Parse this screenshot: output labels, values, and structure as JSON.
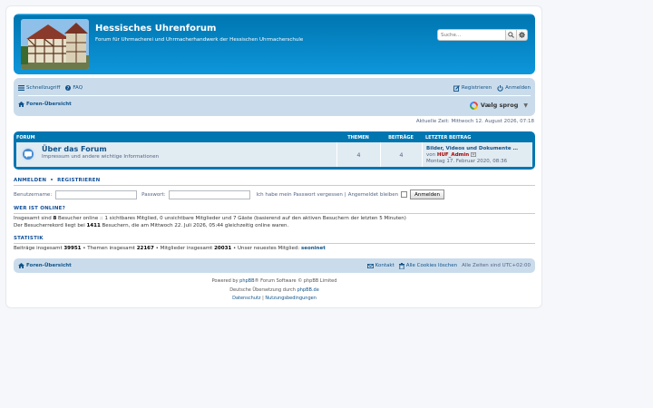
{
  "header": {
    "title": "Hessisches Uhrenforum",
    "description": "Forum für Uhrmacherei und Uhrmacherhandwerk der Hessischen Uhrmacherschule",
    "search_placeholder": "Suche…"
  },
  "navbar": {
    "quicklinks": "Schnellzugriff",
    "faq": "FAQ",
    "register": "Registrieren",
    "login": "Anmelden",
    "breadcrumb": "Foren-Übersicht",
    "translate_label": "Vælg sprog"
  },
  "time": "Aktuelle Zeit: Mittwoch 12. August 2026, 07:18",
  "forum_table": {
    "col_forum": "FORUM",
    "col_topics": "THEMEN",
    "col_posts": "BEITRÄGE",
    "col_last": "LETZTER BEITRAG",
    "row": {
      "title": "Über das Forum",
      "description": "Impressum und andere wichtige Informationen",
      "topics": "4",
      "posts": "4",
      "last_title": "Bilder, Videos und Dokumente …",
      "last_by": "von",
      "last_user": "HUF_Admin",
      "last_date": "Montag 17. Februar 2020, 08:36"
    }
  },
  "login": {
    "heading_login": "ANMELDEN",
    "heading_sep": "•",
    "heading_register": "REGISTRIEREN",
    "username_label": "Benutzername:",
    "password_label": "Passwort:",
    "forgot": "Ich habe mein Passwort vergessen",
    "sep": "|",
    "remember": "Angemeldet bleiben",
    "button": "Anmelden"
  },
  "online": {
    "heading": "WER IST ONLINE?",
    "l1_a": "Insgesamt sind",
    "l1_count": "8",
    "l1_b": "Besucher online :: 1 sichtbares Mitglied, 0 unsichtbare Mitglieder und 7 Gäste (basierend auf den aktiven Besuchern der letzten 5 Minuten)",
    "l2_a": "Der Besucherrekord liegt bei",
    "l2_count": "1411",
    "l2_b": "Besuchern, die am Mittwoch 22. Juli 2026, 05:44 gleichzeitig online waren."
  },
  "stats": {
    "heading": "STATISTIK",
    "posts_label": "Beiträge insgesamt",
    "posts": "39951",
    "topics_label": "• Themen insgesamt",
    "topics": "22167",
    "members_label": "• Mitglieder insgesamt",
    "members": "20031",
    "newest_label": "• Unser neuestes Mitglied:",
    "newest": "seoninet"
  },
  "footer": {
    "breadcrumb": "Foren-Übersicht",
    "contact": "Kontakt",
    "cookies": "Alle Cookies löschen",
    "timezone": "Alle Zeiten sind UTC+02:00",
    "powered_a": "Powered by",
    "powered_link": "phpBB",
    "powered_b": "® Forum Software © phpBB Limited",
    "german_a": "Deutsche Übersetzung durch",
    "german_link": "phpBB.de",
    "privacy": "Datenschutz",
    "sep": "|",
    "terms": "Nutzungsbedingungen"
  },
  "colors": {
    "header_blue": "#12a3eb",
    "nav_bg": "#cadceb",
    "link": "#105289",
    "admin_red": "#aa0000"
  }
}
